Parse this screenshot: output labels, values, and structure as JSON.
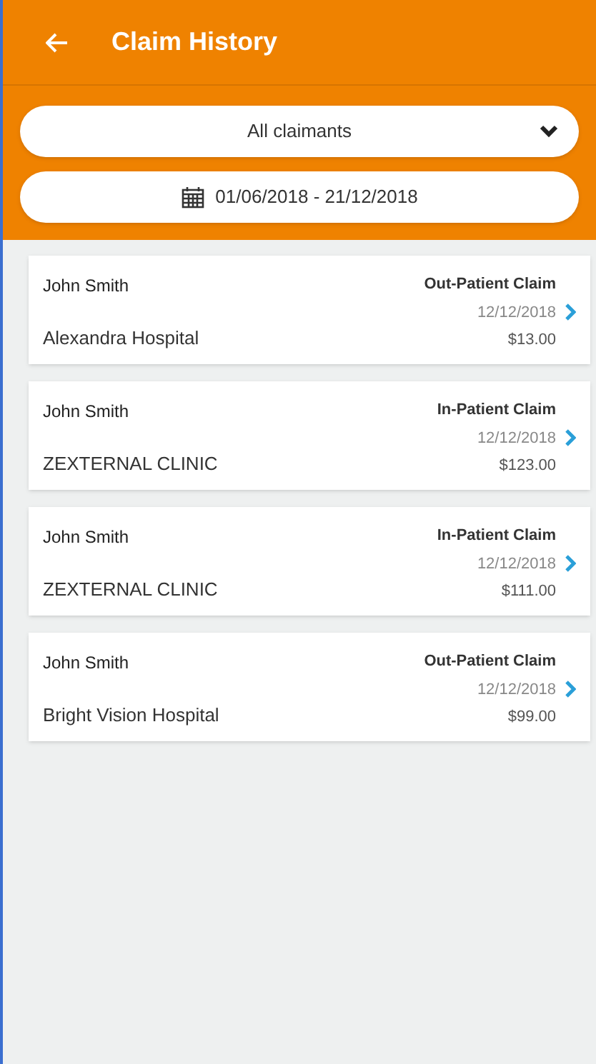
{
  "header": {
    "title": "Claim History"
  },
  "filters": {
    "claimant": "All claimants",
    "date_range": "01/06/2018 - 21/12/2018"
  },
  "claims": [
    {
      "claimant": "John Smith",
      "provider": "Alexandra Hospital",
      "type": "Out-Patient Claim",
      "date": "12/12/2018",
      "amount": "$13.00"
    },
    {
      "claimant": "John Smith",
      "provider": "ZEXTERNAL CLINIC",
      "type": "In-Patient Claim",
      "date": "12/12/2018",
      "amount": "$123.00"
    },
    {
      "claimant": "John Smith",
      "provider": "ZEXTERNAL CLINIC",
      "type": "In-Patient Claim",
      "date": "12/12/2018",
      "amount": "$111.00"
    },
    {
      "claimant": "John Smith",
      "provider": "Bright Vision Hospital",
      "type": "Out-Patient Claim",
      "date": "12/12/2018",
      "amount": "$99.00"
    }
  ]
}
